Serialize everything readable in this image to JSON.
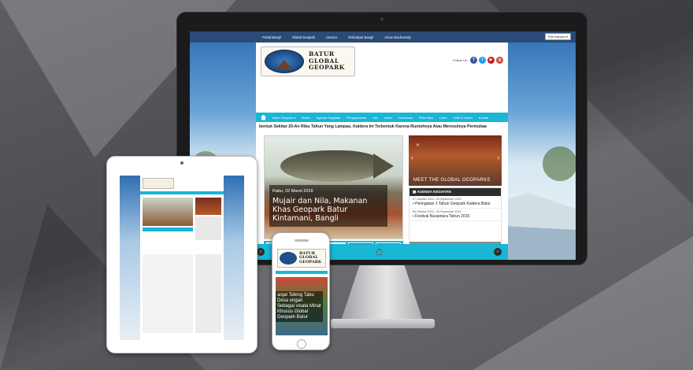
{
  "desktop": {
    "topnav": [
      "Portal Bangli",
      "Global Geopark",
      "Unesco",
      "Disbudpar Bangli",
      "Aman Biodiversity"
    ],
    "language": "Pilih Bahasa",
    "logo_text": [
      "BATUR",
      "GLOBAL",
      "GEOPARK"
    ],
    "follow_label": "Follow Us :",
    "social_icons": [
      "facebook-icon",
      "twitter-icon",
      "youtube-icon",
      "google-plus-icon"
    ],
    "mainnav": [
      "Batur Geopark ▾",
      "Berita",
      "Agenda Kegiatan",
      "Pengumuman",
      "Info",
      "Video",
      "Download",
      "Peta Situs",
      "Links",
      "Kritik & Saran",
      "Kontak"
    ],
    "ticker": "bentuk Sekitar 20-An Ribu Tahun Yang Lampau. Kaldera Ini Terbentuk Karena Runtuhnya Atau Merosotnya Permukaa",
    "slide": {
      "date": "Rabu, 02 Maret 2016",
      "title": "Mujair dan Nila, Makanan Khas Geopark Batur Kintamani, Bangli"
    },
    "sidebox": {
      "caption": "MEET THE GLOBAL GEOPARKS"
    },
    "agenda": {
      "header": "AGENDA KEGIATAN",
      "items": [
        {
          "date": "07 Oktober 2015 - 05 September 2015",
          "title": "Peringatan 1 Tahun Geopark Kaldera Batur"
        },
        {
          "date": "06 Oktober 2015 - 05 September 2015",
          "title": "Festival Nusantara Tahun 2015"
        }
      ],
      "button": "Arsip Agenda"
    }
  },
  "colors": {
    "accent": "#19b6d6",
    "topnav": "#2b4a78",
    "dark": "#2d2d2d"
  },
  "phone": {
    "logo_text": [
      "BATUR",
      "GLOBAL",
      "GEOPARK"
    ],
    "slide_title": "anjat Tebing Tabu Desa ongan Sebagai visata Minat Khusus Global Geopark Batur"
  }
}
